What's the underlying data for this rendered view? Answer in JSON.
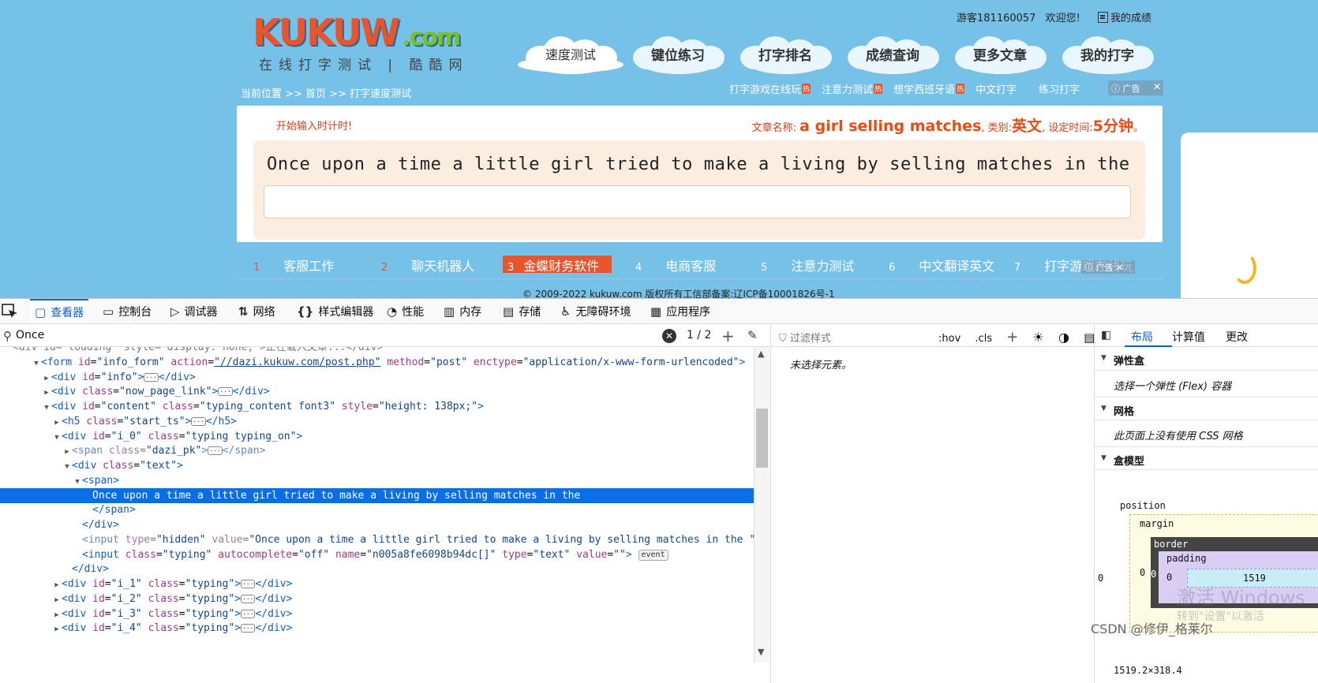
{
  "site": {
    "logo": {
      "text": "KUKUW",
      "domain": ".com",
      "subtitle": "在线打字测试 | 酷酷网"
    },
    "user": {
      "guest": "游客181160057",
      "welcome": "欢迎您!",
      "my_scores": "我的成绩"
    },
    "nav": [
      "速度测试",
      "键位练习",
      "打字排名",
      "成绩查询",
      "更多文章",
      "我的打字"
    ],
    "breadcrumb": "当前位置 >> 首页 >> 打字速度测试",
    "sublinks": [
      "打字游戏在线玩",
      "注意力测试",
      "想学西班牙语",
      "中文打字",
      "练习打字"
    ],
    "sublinks_hot_badge": "热",
    "ad_label": "广告",
    "start_hint": "开始输入时计时!",
    "meta": {
      "name_label": "文章名称:",
      "name": "a girl selling matches",
      "sep1": ",",
      "category_label": "类别:",
      "category": "英文",
      "sep2": ",",
      "time_label": "设定时间:",
      "time": "5分钟",
      "end": "。"
    },
    "typing_text": "Once upon a time a little girl tried to make a living by selling matches in the",
    "typing_input_value": "",
    "hotlist": [
      {
        "n": "1",
        "label": "客服工作"
      },
      {
        "n": "2",
        "label": "聊天机器人"
      },
      {
        "n": "3",
        "label": "金蝶财务软件"
      },
      {
        "n": "4",
        "label": "电商客服"
      },
      {
        "n": "5",
        "label": "注意力测试"
      },
      {
        "n": "6",
        "label": "中文翻译英文"
      },
      {
        "n": "7",
        "label": "打字游戏在线玩"
      }
    ],
    "copyright": "© 2009-2022 kukuw.com 版权所有工信部备案:辽ICP备10001826号-1"
  },
  "devtools": {
    "tabs": [
      "查看器",
      "控制台",
      "调试器",
      "网络",
      "样式编辑器",
      "性能",
      "内存",
      "存储",
      "无障碍环境",
      "应用程序"
    ],
    "tab_icons": [
      "▢",
      "▭",
      "▷",
      "⇅",
      "{}",
      "◔",
      "▥",
      "▤",
      "♿",
      "▦"
    ],
    "search_query": "Once",
    "search_count": "1 / 2",
    "tree": [
      {
        "indent": 4,
        "tw": "",
        "dim": true,
        "text": "<div id=\"loading\" style=\"display: none;\">正在载入文章...</div>"
      },
      {
        "indent": 40,
        "tw": "▼",
        "parts": [
          [
            "tg",
            "<form "
          ],
          [
            "an",
            "id"
          ],
          [
            "",
            "="
          ],
          [
            "av",
            "\"info_form\""
          ],
          [
            "",
            " "
          ],
          [
            "an",
            "action"
          ],
          [
            "",
            "="
          ],
          [
            "avu",
            "\"//dazi.kukuw.com/post.php\""
          ],
          [
            "",
            " "
          ],
          [
            "an",
            "method"
          ],
          [
            "",
            "="
          ],
          [
            "av",
            "\"post\""
          ],
          [
            "",
            " "
          ],
          [
            "an",
            "enctype"
          ],
          [
            "",
            "="
          ],
          [
            "av",
            "\"application/x-www-form-urlencoded\""
          ],
          [
            "tg",
            ">"
          ]
        ]
      },
      {
        "indent": 53,
        "tw": "▶",
        "parts": [
          [
            "tg",
            "<div "
          ],
          [
            "an",
            "id"
          ],
          [
            "",
            "="
          ],
          [
            "av",
            "\"info\""
          ],
          [
            "tg",
            ">"
          ],
          [
            "ell",
            "···"
          ],
          [
            "tg",
            "</div>"
          ]
        ]
      },
      {
        "indent": 53,
        "tw": "▶",
        "parts": [
          [
            "tg",
            "<div "
          ],
          [
            "an",
            "class"
          ],
          [
            "",
            "="
          ],
          [
            "av",
            "\"now_page_link\""
          ],
          [
            "tg",
            ">"
          ],
          [
            "ell",
            "···"
          ],
          [
            "tg",
            "</div>"
          ]
        ]
      },
      {
        "indent": 53,
        "tw": "▼",
        "parts": [
          [
            "tg",
            "<div "
          ],
          [
            "an",
            "id"
          ],
          [
            "",
            "="
          ],
          [
            "av",
            "\"content\""
          ],
          [
            "",
            " "
          ],
          [
            "an",
            "class"
          ],
          [
            "",
            "="
          ],
          [
            "av",
            "\"typing_content font3\""
          ],
          [
            "",
            " "
          ],
          [
            "an",
            "style"
          ],
          [
            "",
            "="
          ],
          [
            "av",
            "\"height: 138px;\""
          ],
          [
            "tg",
            ">"
          ]
        ]
      },
      {
        "indent": 66,
        "tw": "▶",
        "parts": [
          [
            "tg",
            "<h5 "
          ],
          [
            "an",
            "class"
          ],
          [
            "",
            "="
          ],
          [
            "av",
            "\"start_ts\""
          ],
          [
            "tg",
            ">"
          ],
          [
            "ell",
            "···"
          ],
          [
            "tg",
            "</h5>"
          ]
        ]
      },
      {
        "indent": 66,
        "tw": "▼",
        "parts": [
          [
            "tg",
            "<div "
          ],
          [
            "an",
            "id"
          ],
          [
            "",
            "="
          ],
          [
            "av",
            "\"i_0\""
          ],
          [
            "",
            " "
          ],
          [
            "an",
            "class"
          ],
          [
            "",
            "="
          ],
          [
            "av",
            "\"typing typing_on\""
          ],
          [
            "tg",
            ">"
          ]
        ]
      },
      {
        "indent": 79,
        "tw": "▶",
        "dimline": true,
        "parts": [
          [
            "tg",
            "<span "
          ],
          [
            "an",
            "class"
          ],
          [
            "",
            "="
          ],
          [
            "av",
            "\"dazi_pk\""
          ],
          [
            "tg",
            ">"
          ],
          [
            "ell",
            "···"
          ],
          [
            "tg",
            "</span>"
          ]
        ]
      },
      {
        "indent": 79,
        "tw": "▼",
        "parts": [
          [
            "tg",
            "<div "
          ],
          [
            "an",
            "class"
          ],
          [
            "",
            "="
          ],
          [
            "av",
            "\"text\""
          ],
          [
            "tg",
            ">"
          ]
        ]
      },
      {
        "indent": 92,
        "tw": "▼",
        "parts": [
          [
            "tg",
            "<span>"
          ]
        ]
      },
      {
        "indent": 105,
        "tw": "",
        "sel": true,
        "parts": [
          [
            "",
            "Once upon a time a little girl tried to make a living by selling matches in the"
          ]
        ]
      },
      {
        "indent": 105,
        "tw": "",
        "parts": [
          [
            "tg",
            "</span>"
          ]
        ]
      },
      {
        "indent": 92,
        "tw": "",
        "parts": [
          [
            "tg",
            "</div>"
          ]
        ]
      },
      {
        "indent": 92,
        "tw": "",
        "dimline": true,
        "parts": [
          [
            "tg",
            "<input "
          ],
          [
            "an",
            "type"
          ],
          [
            "",
            "="
          ],
          [
            "av",
            "\"hidden\""
          ],
          [
            "",
            " "
          ],
          [
            "an",
            "value"
          ],
          [
            "",
            "="
          ],
          [
            "av",
            "\"Once upon a time a little girl tried to make a living by selling matches in the \""
          ],
          [
            "tg",
            ">"
          ]
        ]
      },
      {
        "indent": 92,
        "tw": "",
        "parts": [
          [
            "tg",
            "<input "
          ],
          [
            "an",
            "class"
          ],
          [
            "",
            "="
          ],
          [
            "av",
            "\"typing\""
          ],
          [
            "",
            " "
          ],
          [
            "an",
            "autocomplete"
          ],
          [
            "",
            "="
          ],
          [
            "av",
            "\"off\""
          ],
          [
            "",
            " "
          ],
          [
            "an",
            "name"
          ],
          [
            "",
            "="
          ],
          [
            "av",
            "\"n005a8fe6098b94dc[]\""
          ],
          [
            "",
            " "
          ],
          [
            "an",
            "type"
          ],
          [
            "",
            "="
          ],
          [
            "av",
            "\"text\""
          ],
          [
            "",
            " "
          ],
          [
            "an",
            "value"
          ],
          [
            "",
            "="
          ],
          [
            "av",
            "\"\""
          ],
          [
            "tg",
            ">"
          ],
          [
            "",
            " "
          ],
          [
            "evt",
            "event"
          ]
        ]
      },
      {
        "indent": 79,
        "tw": "",
        "parts": [
          [
            "tg",
            "</div>"
          ]
        ]
      },
      {
        "indent": 66,
        "tw": "▶",
        "parts": [
          [
            "tg",
            "<div "
          ],
          [
            "an",
            "id"
          ],
          [
            "",
            "="
          ],
          [
            "av",
            "\"i_1\""
          ],
          [
            "",
            " "
          ],
          [
            "an",
            "class"
          ],
          [
            "",
            "="
          ],
          [
            "av",
            "\"typing\""
          ],
          [
            "tg",
            ">"
          ],
          [
            "ell",
            "···"
          ],
          [
            "tg",
            "</div>"
          ]
        ]
      },
      {
        "indent": 66,
        "tw": "▶",
        "parts": [
          [
            "tg",
            "<div "
          ],
          [
            "an",
            "id"
          ],
          [
            "",
            "="
          ],
          [
            "av",
            "\"i_2\""
          ],
          [
            "",
            " "
          ],
          [
            "an",
            "class"
          ],
          [
            "",
            "="
          ],
          [
            "av",
            "\"typing\""
          ],
          [
            "tg",
            ">"
          ],
          [
            "ell",
            "···"
          ],
          [
            "tg",
            "</div>"
          ]
        ]
      },
      {
        "indent": 66,
        "tw": "▶",
        "parts": [
          [
            "tg",
            "<div "
          ],
          [
            "an",
            "id"
          ],
          [
            "",
            "="
          ],
          [
            "av",
            "\"i_3\""
          ],
          [
            "",
            " "
          ],
          [
            "an",
            "class"
          ],
          [
            "",
            "="
          ],
          [
            "av",
            "\"typing\""
          ],
          [
            "tg",
            ">"
          ],
          [
            "ell",
            "···"
          ],
          [
            "tg",
            "</div>"
          ]
        ]
      },
      {
        "indent": 66,
        "tw": "▶",
        "parts": [
          [
            "tg",
            "<div "
          ],
          [
            "an",
            "id"
          ],
          [
            "",
            "="
          ],
          [
            "av",
            "\"i_4\""
          ],
          [
            "",
            " "
          ],
          [
            "an",
            "class"
          ],
          [
            "",
            "="
          ],
          [
            "av",
            "\"typing\""
          ],
          [
            "tg",
            ">"
          ],
          [
            "ell",
            "···"
          ],
          [
            "tg",
            "</div>"
          ]
        ]
      }
    ],
    "rules": {
      "filter_placeholder": "过滤样式",
      "hov": ":hov",
      "cls": ".cls",
      "no_selection": "未选择元素。"
    },
    "layout": {
      "tabs": [
        "布局",
        "计算值",
        "更改"
      ],
      "flex_title": "弹性盒",
      "flex_note": "选择一个弹性 (Flex) 容器",
      "grid_title": "网格",
      "grid_note": "此页面上没有使用 CSS 网格",
      "boxmodel_title": "盒模型",
      "position": "position",
      "margin": "margin",
      "border": "border",
      "padding": "padding",
      "content_width": "1519",
      "zero": "0",
      "dims": "1519.2×318.4"
    },
    "watermark": "激活 Windows",
    "watermark_sub": "转到\"设置\"以激活",
    "csdn": "CSDN @修伊_格莱尔"
  }
}
